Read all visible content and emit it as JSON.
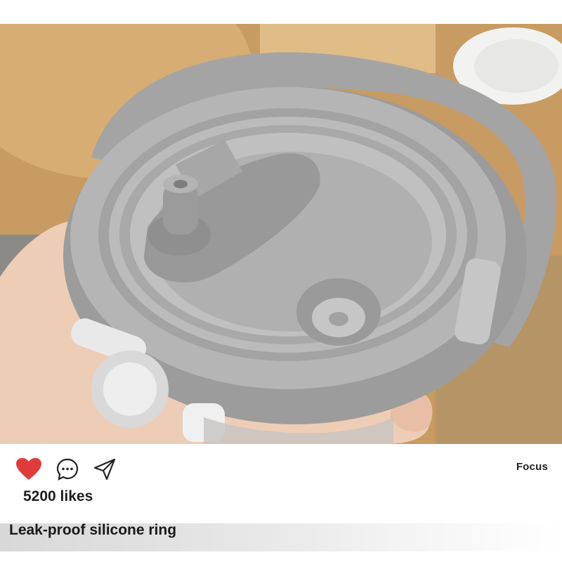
{
  "post": {
    "image_subject": "grey bottle lid with straw spout, held in hand",
    "likes_text": "5200 likes",
    "focus_label": "Focus",
    "caption": "Leak-proof silicone ring"
  },
  "icons": {
    "like": "heart-icon",
    "comment": "comment-icon",
    "share": "share-icon"
  },
  "colors": {
    "heart": "#e03b3b",
    "text": "#1e1e1e",
    "lid_grey": "#a9a9a9"
  }
}
